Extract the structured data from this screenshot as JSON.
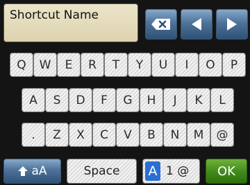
{
  "input": {
    "value": "Shortcut Name"
  },
  "toolbar": {
    "backspace_icon": "backspace-icon",
    "left_icon": "arrow-left-icon",
    "right_icon": "arrow-right-icon"
  },
  "keyboard": {
    "rows": [
      [
        "Q",
        "W",
        "E",
        "R",
        "T",
        "Y",
        "U",
        "I",
        "O",
        "P"
      ],
      [
        "A",
        "S",
        "D",
        "F",
        "G",
        "H",
        "J",
        "K",
        "L"
      ],
      [
        ".",
        "Z",
        "X",
        "C",
        "V",
        "B",
        "N",
        "M",
        "@"
      ]
    ]
  },
  "bottom": {
    "shift_label": "aA",
    "shift_icon": "shift-up-arrow-icon",
    "space_label": "Space",
    "mode_active": "A",
    "mode_rest": "1 @",
    "ok_label": "OK"
  },
  "colors": {
    "background": "#141414",
    "blue_button": "#4e729a",
    "ok_green": "#3f8a19",
    "mode_highlight": "#2a6fd1"
  }
}
